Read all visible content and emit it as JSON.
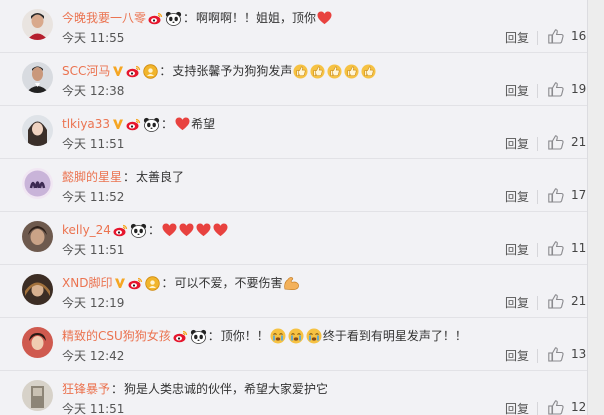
{
  "reply_label": "回复",
  "colors": {
    "username": "#eb7350",
    "heart": "#e8423f",
    "vip_badge": "#f5a623",
    "background": "#f2f2f5"
  },
  "comments": [
    {
      "username": "今晚我要一八零",
      "badges": [
        "weibo-logo-badge",
        "panda-badge"
      ],
      "text": "啊啊啊！！姐姐，顶你",
      "trailing_emoji": [
        "heart"
      ],
      "time": "今天 11:55",
      "likes": "16"
    },
    {
      "username": "SCC河马",
      "badges": [
        "v-badge",
        "weibo-logo-badge",
        "gold-medal-badge"
      ],
      "text": "支持张馨予为狗狗发声",
      "trailing_emoji": [
        "thumbs-up",
        "thumbs-up",
        "thumbs-up",
        "thumbs-up",
        "thumbs-up"
      ],
      "time": "今天 12:38",
      "likes": "19"
    },
    {
      "username": "tlkiya33",
      "badges": [
        "v-badge",
        "weibo-logo-badge",
        "panda-badge"
      ],
      "leading_emoji": [
        "heart"
      ],
      "text": "希望",
      "time": "今天 11:51",
      "likes": "21"
    },
    {
      "username": "懿脚的星星",
      "badges": [],
      "text": "太善良了",
      "time": "今天 11:52",
      "likes": "17"
    },
    {
      "username": "kelly_24",
      "badges": [
        "weibo-logo-badge",
        "panda-badge"
      ],
      "leading_emoji": [
        "heart",
        "heart",
        "heart",
        "heart"
      ],
      "text": "",
      "time": "今天 11:51",
      "likes": "11"
    },
    {
      "username": "XND脚印",
      "badges": [
        "v-badge",
        "weibo-logo-badge",
        "gold-medal-badge"
      ],
      "text": "可以不爱，不要伤害",
      "trailing_emoji": [
        "strong-arm"
      ],
      "time": "今天 12:19",
      "likes": "21"
    },
    {
      "username": "精致的CSU狗狗女孩",
      "badges": [
        "weibo-logo-badge",
        "panda-badge"
      ],
      "text": "顶你！！",
      "text2": "终于看到有明星发声了！！",
      "mid_emoji": [
        "crying-face",
        "crying-face",
        "crying-face"
      ],
      "time": "今天 12:42",
      "likes": "13"
    },
    {
      "username": "狂锋暴予",
      "badges": [],
      "text": "狗是人类忠诚的伙伴，希望大家爱护它",
      "time": "今天 11:51",
      "likes": "12"
    }
  ]
}
